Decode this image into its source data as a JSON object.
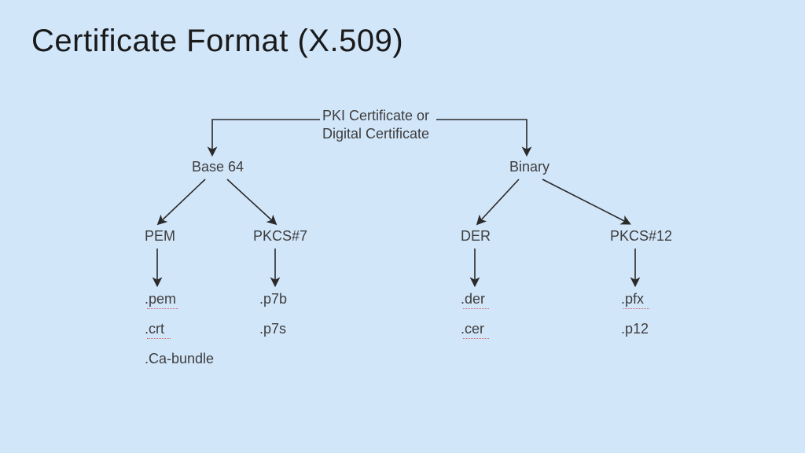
{
  "title": "Certificate Format (X.509)",
  "root": {
    "line1": "PKI Certificate or",
    "line2": "Digital Certificate"
  },
  "left": {
    "label": "Base 64",
    "childA": "PEM",
    "childB": "PKCS#7"
  },
  "right": {
    "label": "Binary",
    "childA": "DER",
    "childB": "PKCS#12"
  },
  "ext": {
    "pem": [
      ".pem",
      ".crt",
      ".Ca-bundle"
    ],
    "pkcs7": [
      ".p7b",
      ".p7s"
    ],
    "der": [
      ".der",
      ".cer"
    ],
    "pkcs12": [
      ".pfx",
      ".p12"
    ]
  }
}
